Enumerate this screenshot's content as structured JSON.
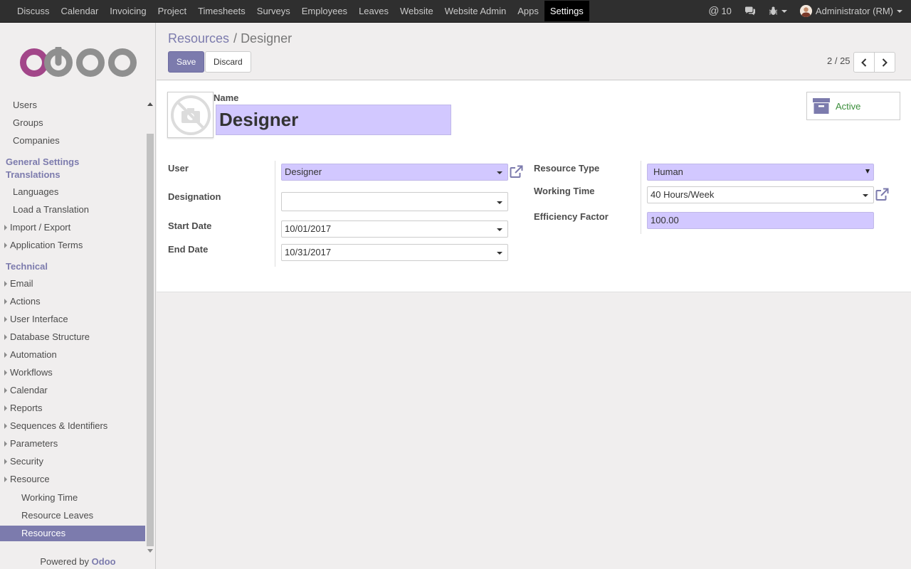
{
  "topbar": {
    "menu": [
      "Discuss",
      "Calendar",
      "Invoicing",
      "Project",
      "Timesheets",
      "Surveys",
      "Employees",
      "Leaves",
      "Website",
      "Website Admin",
      "Apps",
      "Settings"
    ],
    "active_menu": "Settings",
    "mention_count": "10",
    "user_name": "Administrator (RM)"
  },
  "sidebar": {
    "logo_text": "odoo",
    "items": {
      "users": "Users",
      "groups": "Groups",
      "companies": "Companies",
      "general_settings": "General Settings",
      "translations": "Translations",
      "languages": "Languages",
      "load_translation": "Load a Translation",
      "import_export": "Import / Export",
      "application_terms": "Application Terms",
      "technical": "Technical",
      "email": "Email",
      "actions": "Actions",
      "user_interface": "User Interface",
      "database_structure": "Database Structure",
      "automation": "Automation",
      "workflows": "Workflows",
      "calendar": "Calendar",
      "reports": "Reports",
      "sequences": "Sequences & Identifiers",
      "parameters": "Parameters",
      "security": "Security",
      "resource": "Resource",
      "working_time": "Working Time",
      "resource_leaves": "Resource Leaves",
      "resources": "Resources"
    },
    "powered_by": "Powered by",
    "powered_brand": "Odoo"
  },
  "control_panel": {
    "breadcrumb_parent": "Resources",
    "breadcrumb_separator": "/",
    "breadcrumb_current": "Designer",
    "save_label": "Save",
    "discard_label": "Discard",
    "pager": "2 / 25"
  },
  "form": {
    "name_label": "Name",
    "name_value": "Designer",
    "active_label": "Active",
    "user_label": "User",
    "user_value": "Designer",
    "designation_label": "Designation",
    "designation_value": "",
    "start_date_label": "Start Date",
    "start_date_value": "10/01/2017",
    "end_date_label": "End Date",
    "end_date_value": "10/31/2017",
    "resource_type_label": "Resource Type",
    "resource_type_value": "Human",
    "working_time_label": "Working Time",
    "working_time_value": "40 Hours/Week",
    "efficiency_label": "Efficiency Factor",
    "efficiency_value": "100.00"
  },
  "colors": {
    "accent": "#7c7bad",
    "required_field": "#d2c8ff",
    "topbar": "#2f2f2f",
    "active_green": "#3b8e3b"
  }
}
